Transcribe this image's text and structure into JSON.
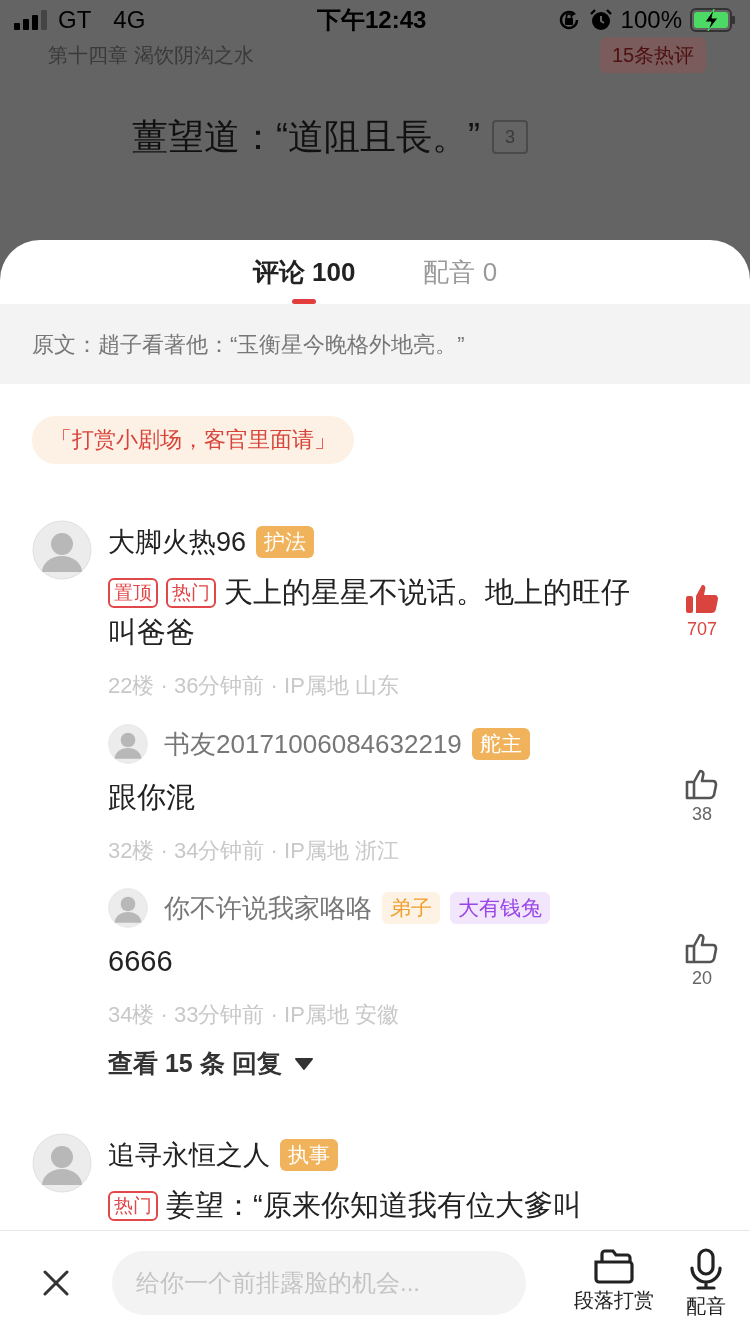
{
  "status_bar": {
    "carrier": "GT",
    "network": "4G",
    "time": "下午12:43",
    "battery": "100%"
  },
  "reader": {
    "chapter": "第十四章 渴饮阴沟之水",
    "hot_comments": "15条热评",
    "line": "薑望道：“道阻且長。”",
    "line_comments": "3"
  },
  "sheet": {
    "tabs": [
      {
        "label": "评论 100",
        "selected": true
      },
      {
        "label": "配音 0",
        "selected": false
      }
    ],
    "original": "原文：趙子看著他：“玉衡星今晚格外地亮。”",
    "reward_banner": "「打赏小剧场，客官里面请」",
    "comments": [
      {
        "user": "大脚火热96",
        "badges": [
          {
            "text": "护法",
            "kind": "solid",
            "color": "#f0b25a"
          }
        ],
        "tags": [
          "置顶",
          "热门"
        ],
        "text": "天上的星星不说话。地上的旺仔叫爸爸",
        "meta": "22楼 · 36分钟前 · IP属地 山东",
        "likes": "707",
        "liked": true,
        "replies": [
          {
            "user": "书友20171006084632219",
            "badges": [
              {
                "text": "舵主",
                "kind": "solid",
                "color": "#f0b25a"
              }
            ],
            "text": "跟你混",
            "meta": "32楼 · 34分钟前 · IP属地 浙江",
            "likes": "38",
            "liked": false
          },
          {
            "user": "你不许说我家咯咯",
            "badges": [
              {
                "text": "弟子",
                "kind": "soft",
                "color": "#f0a030"
              },
              {
                "text": "大有钱兔",
                "kind": "soft",
                "color": "#9a45e8"
              }
            ],
            "text": "6666",
            "meta": "34楼 · 33分钟前 · IP属地 安徽",
            "likes": "20",
            "liked": false
          }
        ],
        "more_replies": "查看 15 条 回复"
      },
      {
        "user": "追寻永恒之人",
        "badges": [
          {
            "text": "执事",
            "kind": "solid",
            "color": "#f0b25a"
          }
        ],
        "tags": [
          "热门"
        ],
        "text": "姜望：“原来你知道我有位大爹叫"
      }
    ]
  },
  "bottom_bar": {
    "placeholder": "给你一个前排露脸的机会...",
    "actions": [
      {
        "kind": "reward",
        "label": "段落打赏"
      },
      {
        "kind": "voice",
        "label": "配音"
      }
    ]
  }
}
